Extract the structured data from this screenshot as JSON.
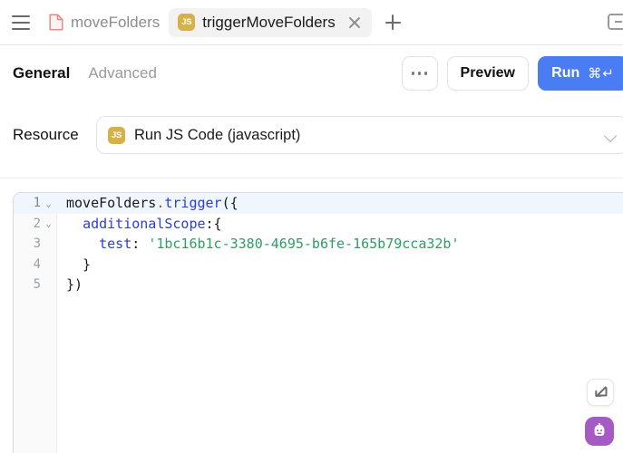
{
  "tabbar": {
    "menu_icon": "hamburger-icon",
    "tabs": [
      {
        "label": "moveFolders",
        "icon": "document-icon",
        "active": false
      },
      {
        "label": "triggerMoveFolders",
        "icon": "js-badge-icon",
        "badge": "JS",
        "active": true
      }
    ],
    "close_icon": "close-icon",
    "add_icon": "plus-icon",
    "panel_icon": "panel-layout-icon"
  },
  "toolbar": {
    "tabs": [
      {
        "label": "General",
        "active": true
      },
      {
        "label": "Advanced",
        "active": false
      }
    ],
    "more_label": "…",
    "preview_label": "Preview",
    "run_label": "Run",
    "run_shortcut": "⌘↵",
    "accent_color": "#4a7cf4"
  },
  "resource": {
    "label": "Resource",
    "badge": "JS",
    "value": "Run JS Code (javascript)",
    "chevron_icon": "chevron-down-icon"
  },
  "editor": {
    "language": "javascript",
    "active_line": 1,
    "lines": [
      {
        "num": "1",
        "foldable": true,
        "tokens": [
          {
            "t": "moveFolders",
            "c": "t-plain"
          },
          {
            "t": ".",
            "c": "t-dot"
          },
          {
            "t": "trigger",
            "c": "t-fn"
          },
          {
            "t": "({",
            "c": "t-plain"
          }
        ]
      },
      {
        "num": "2",
        "foldable": true,
        "tokens": [
          {
            "t": "  ",
            "c": "t-plain"
          },
          {
            "t": "additionalScope",
            "c": "t-prop"
          },
          {
            "t": ":{",
            "c": "t-plain"
          }
        ]
      },
      {
        "num": "3",
        "foldable": false,
        "tokens": [
          {
            "t": "    ",
            "c": "t-plain"
          },
          {
            "t": "test",
            "c": "t-prop"
          },
          {
            "t": ": ",
            "c": "t-plain"
          },
          {
            "t": "'1bc16b1c-3380-4695-b6fe-165b79cca32b'",
            "c": "t-string"
          }
        ]
      },
      {
        "num": "4",
        "foldable": false,
        "tokens": [
          {
            "t": "  }",
            "c": "t-plain"
          }
        ]
      },
      {
        "num": "5",
        "foldable": false,
        "tokens": [
          {
            "t": "})",
            "c": "t-plain"
          }
        ]
      }
    ],
    "fold_glyph": "⌄"
  },
  "floating": {
    "collapse_icon": "collapse-arrow-icon",
    "ai_icon": "robot-icon",
    "ai_color": "#a45bc4"
  }
}
